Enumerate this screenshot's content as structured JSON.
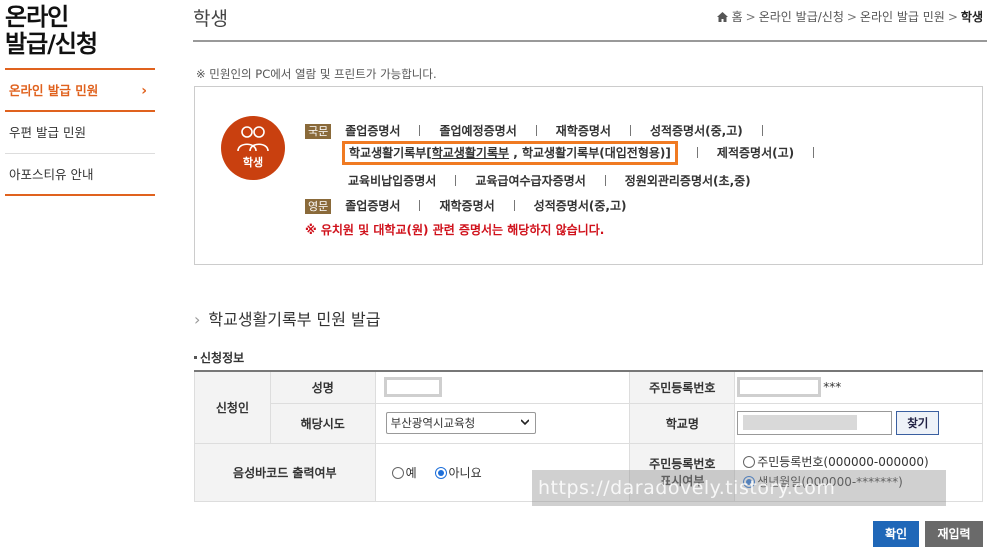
{
  "sidebar": {
    "title_line1": "온라인",
    "title_line2": "발급/신청",
    "items": [
      {
        "label": "온라인 발급 민원"
      },
      {
        "label": "우편 발급 민원"
      },
      {
        "label": "아포스티유 안내"
      }
    ],
    "accent": "#e0621e"
  },
  "header": {
    "title": "학생",
    "breadcrumb": [
      "홈",
      "온라인 발급/신청",
      "온라인 발급 민원",
      "학생"
    ]
  },
  "notice": "※ 민원인의 PC에서 열람 및 프린트가 가능합니다.",
  "certs": {
    "badge_label": "학생",
    "korean_tag": "국문",
    "english_tag": "영문",
    "korean_row1": [
      "졸업증명서",
      "졸업예정증명서",
      "재학증명서",
      "성적증명서(중,고)"
    ],
    "highlight_main": "학교생활기록부[",
    "highlight_sub1": "학교생활기록부",
    "highlight_mid": " , 학교생활기록부(대입전형용)]",
    "korean_row2_after": "제적증명서(고)",
    "korean_row3": [
      "교육비납입증명서",
      "교육급여수급자증명서",
      "정원외관리증명서(초,중)"
    ],
    "english_row": [
      "졸업증명서",
      "재학증명서",
      "성적증명서(중,고)"
    ],
    "warning": "※ 유치원 및 대학교(원) 관련 증명서는 해당하지 않습니다.",
    "highlight_color": "#f07a22"
  },
  "section": {
    "title": "학교생활기록부 민원 발급",
    "subsection": "신청정보"
  },
  "form": {
    "applicant_label": "신청인",
    "name_label": "성명",
    "rrn_label": "주민등록번호",
    "rrn_suffix": "***",
    "region_label": "해당시도",
    "region_value": "부산광역시교육청",
    "school_label": "학교명",
    "find_button": "찾기",
    "barcode_label": "음성바코드 출력여부",
    "barcode_yes": "예",
    "barcode_no": "아니요",
    "display_label_line1": "주민등록번호",
    "display_label_line2": "표시여부",
    "display_opt1": "주민등록번호(000000-000000)",
    "display_opt2": "생년월일(000000-*******)"
  },
  "watermark": "https://daradovely.tistory.com",
  "buttons": {
    "confirm": "확인",
    "reset": "재입력"
  }
}
